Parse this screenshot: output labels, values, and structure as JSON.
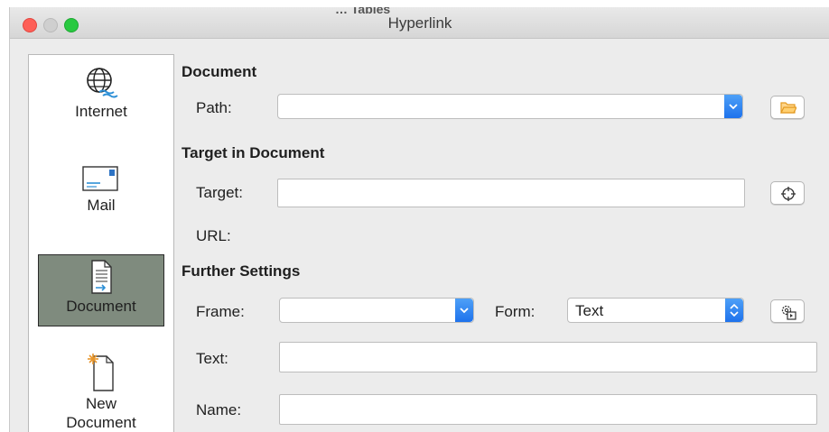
{
  "window": {
    "title": "Hyperlink",
    "background_peek_text": "… Tables"
  },
  "sidebar": {
    "items": [
      {
        "label": "Internet",
        "icon": "globe-icon",
        "selected": false
      },
      {
        "label": "Mail",
        "icon": "mail-envelope-icon",
        "selected": false
      },
      {
        "label": "Document",
        "icon": "document-icon",
        "selected": true
      },
      {
        "label_line1": "New",
        "label_line2": "Document",
        "icon": "new-document-icon",
        "selected": false
      }
    ]
  },
  "document": {
    "heading": "Document",
    "path_label": "Path:",
    "path_value": ""
  },
  "target_in_document": {
    "heading": "Target in Document",
    "target_label": "Target:",
    "target_value": "",
    "url_label": "URL:",
    "url_value": ""
  },
  "further_settings": {
    "heading": "Further Settings",
    "frame_label": "Frame:",
    "frame_value": "",
    "form_label": "Form:",
    "form_value": "Text",
    "text_label": "Text:",
    "text_value": "",
    "name_label": "Name:",
    "name_value": ""
  },
  "colors": {
    "selected_sidebar": "#7f8b7e",
    "accent_blue": "#1e72ec",
    "folder_orange": "#f0a83a"
  }
}
